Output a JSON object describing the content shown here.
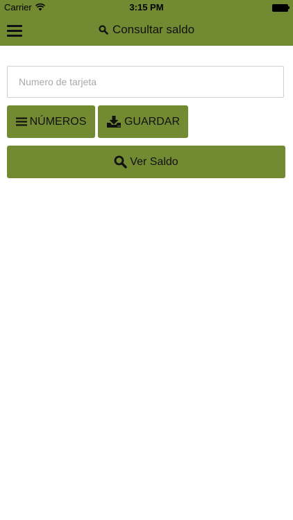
{
  "status_bar": {
    "carrier": "Carrier",
    "time": "3:15 PM"
  },
  "nav": {
    "title": "Consultar saldo",
    "menu_icon": "hamburger-icon",
    "title_icon": "search-icon"
  },
  "form": {
    "card_number_placeholder": "Numero de tarjeta",
    "card_number_value": ""
  },
  "buttons": {
    "numeros_label": "NÚMEROS",
    "numeros_icon": "list-icon",
    "guardar_label": "GUARDAR",
    "guardar_icon": "download-tray-icon",
    "ver_saldo_label": "Ver Saldo",
    "ver_saldo_icon": "search-icon"
  },
  "colors": {
    "accent": "#728a31",
    "background": "#ffffff",
    "text": "#111111",
    "placeholder": "#a9a9a9",
    "input_border": "#cfcfcf"
  }
}
